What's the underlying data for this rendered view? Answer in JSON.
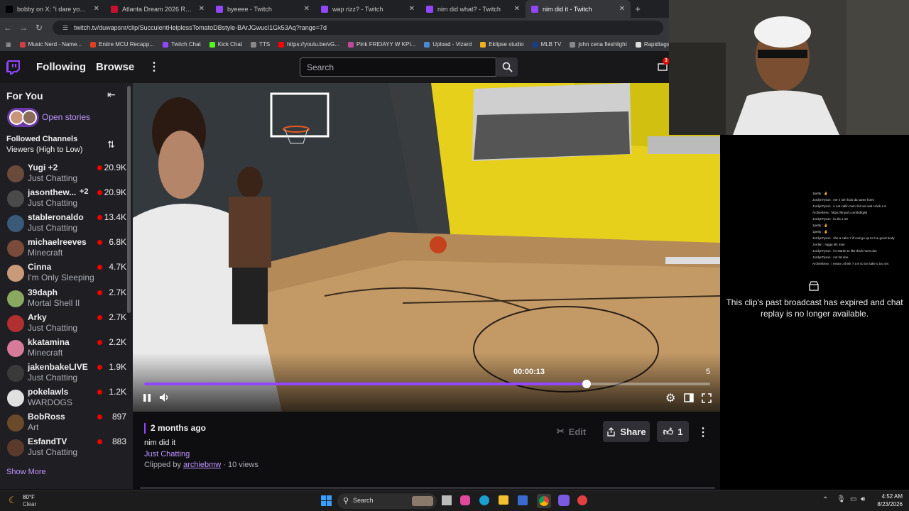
{
  "browser": {
    "tabs": [
      {
        "title": "bobby on X: \"i dare you to unm",
        "color": "#000000"
      },
      {
        "title": "Atlanta Dream 2026 Regular Se",
        "color": "#c8102e"
      },
      {
        "title": "byeeee - Twitch",
        "color": "#9146ff"
      },
      {
        "title": "wap rizz? - Twitch",
        "color": "#9146ff"
      },
      {
        "title": "nim did what? - Twitch",
        "color": "#9146ff"
      },
      {
        "title": "nim did it - Twitch",
        "color": "#9146ff"
      }
    ],
    "url": "twitch.tv/duwapsnr/clip/SucculentHelplessTomatoDBstyle-BArJGwucI1Gk53Aq?range=7d",
    "bookmarks": [
      "Music Nerd - Name...",
      "Entire MCU Recapp...",
      "Twitch Chat",
      "Kick Chat",
      "TTS",
      "https://youtu.be/vG...",
      "Pink FRIDAYY W KPI...",
      "Upload - Vizard",
      "Eklipse studio",
      "MLB TV",
      "john cena fleshlight",
      "Rapidtags | YouTub..."
    ]
  },
  "twitch": {
    "nav_following": "Following",
    "nav_browse": "Browse",
    "search_placeholder": "Search",
    "notif_count": "3"
  },
  "sidebar": {
    "for_you": "For You",
    "open_stories": "Open stories",
    "followed_title": "Followed Channels",
    "followed_sort": "Viewers (High to Low)",
    "show_more": "Show More",
    "channels": [
      {
        "name": "Yugi +2",
        "game": "Just Chatting",
        "viewers": "20.9K",
        "color": "#6a4a3a"
      },
      {
        "name": "jasonthew...",
        "extra": "+2",
        "game": "Just Chatting",
        "viewers": "20.9K",
        "color": "#4a4a4a"
      },
      {
        "name": "stableronaldo",
        "game": "Just Chatting",
        "viewers": "13.4K",
        "color": "#3a5a7a"
      },
      {
        "name": "michaelreeves",
        "game": "Minecraft",
        "viewers": "6.8K",
        "color": "#7a4a3a"
      },
      {
        "name": "Cinna",
        "game": "I'm Only Sleeping",
        "viewers": "4.7K",
        "color": "#c89a7a"
      },
      {
        "name": "39daph",
        "game": "Mortal Shell II",
        "viewers": "2.7K",
        "color": "#8aa860"
      },
      {
        "name": "Arky",
        "game": "Just Chatting",
        "viewers": "2.7K",
        "color": "#b03030"
      },
      {
        "name": "kkatamina",
        "game": "Minecraft",
        "viewers": "2.2K",
        "color": "#d87a9a"
      },
      {
        "name": "jakenbakeLIVE",
        "game": "Just Chatting",
        "viewers": "1.9K",
        "color": "#3a3a3a"
      },
      {
        "name": "pokelawls",
        "game": "WARDOGS",
        "viewers": "1.2K",
        "color": "#e0e0e0"
      },
      {
        "name": "BobRoss",
        "game": "Art",
        "viewers": "897",
        "color": "#6a4a2a"
      },
      {
        "name": "EsfandTV",
        "game": "Just Chatting",
        "viewers": "883",
        "color": "#5a3a2a"
      }
    ]
  },
  "player": {
    "timestamp": "00:00:13",
    "right_num": "5",
    "progress": 0.782
  },
  "clip": {
    "age": "2 months ago",
    "title": "nim did it",
    "category": "Just Chatting",
    "clipped_by_prefix": "Clipped by",
    "clipper": "archiebmw",
    "views": "· 10 views",
    "edit": "Edit",
    "share": "Share",
    "likes": "1"
  },
  "chat": {
    "expired_msg": "This clip's past broadcast has expired and chat replay is no longer available.",
    "overlay_lines": [
      "1petty : ✌",
      "JordynTyson : me n nim fuck da same hoes",
      "JordynTyson : u not callin nam shit we wat crack a 6",
      "ArchieBmw : https://tinyurl.com/bdfqjsk",
      "JordynTyson : la dis a 19",
      "1petty : ✌",
      "1petty : ✌",
      "JordynTyson : she a calm 7 ill cud go up to 9 w good body",
      "Jordan : nigga tits man",
      "JordynTyson : im startin to like thick hoes doe",
      "JordynTyson : not fat doe",
      "ArchieBmw : i mean u think ? a 8 so ion take u too srs"
    ]
  },
  "taskbar": {
    "weather_temp": "80°F",
    "weather_cond": "Clear",
    "search": "Search",
    "time": "4:52 AM",
    "date": "8/23/2026"
  }
}
